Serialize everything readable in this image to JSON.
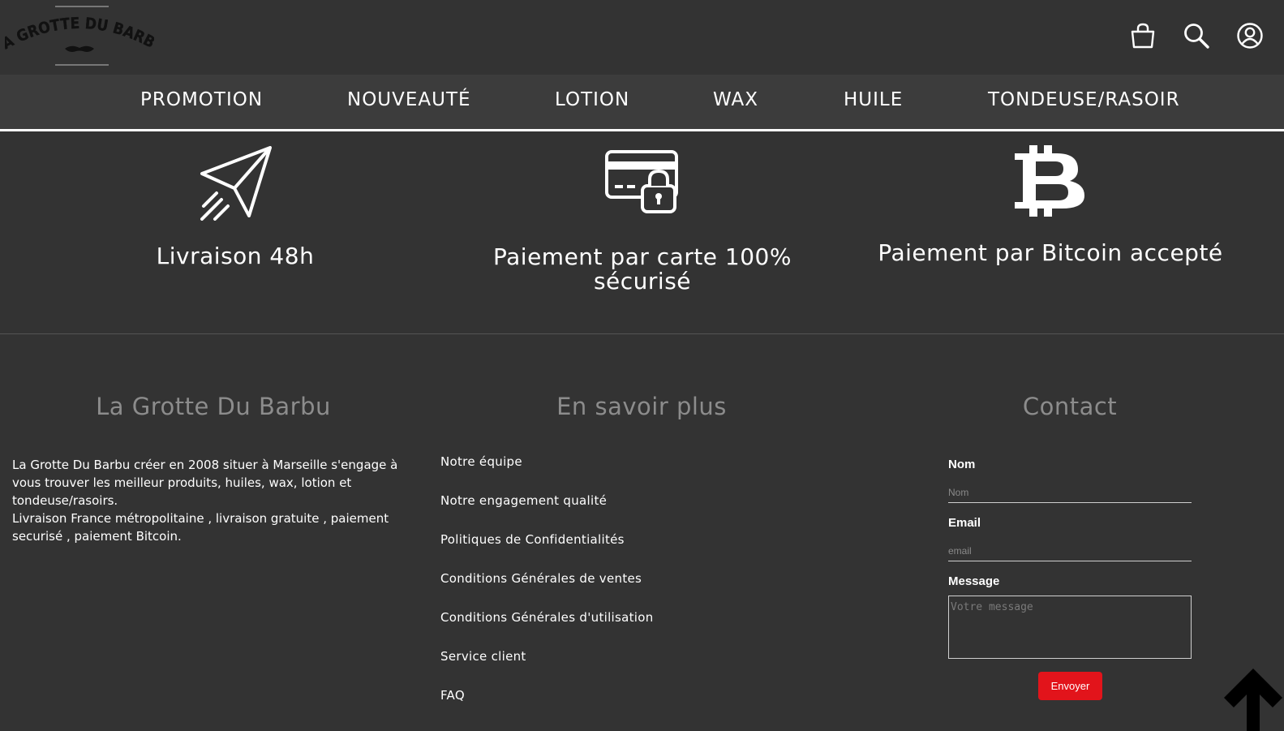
{
  "header": {
    "logo_text": "LA GROTTE DU BARBU",
    "icons": [
      "shopping-bag-icon",
      "search-icon",
      "user-account-icon"
    ]
  },
  "nav": {
    "items": [
      "PROMOTION",
      "NOUVEAUTÉ",
      "LOTION",
      "WAX",
      "HUILE",
      "TONDEUSE/RASOIR"
    ]
  },
  "features": [
    {
      "icon": "paper-plane-icon",
      "text": "Livraison 48h"
    },
    {
      "icon": "secure-card-icon",
      "text": "Paiement par carte 100% sécurisé"
    },
    {
      "icon": "bitcoin-icon",
      "text": "Paiement par Bitcoin accepté"
    }
  ],
  "footer": {
    "about": {
      "title": "La Grotte Du Barbu",
      "paragraph1": "La Grotte Du Barbu créer en 2008 situer à Marseille s'engage à vous trouver les meilleur produits, huiles, wax, lotion et tondeuse/rasoirs.",
      "paragraph2": "Livraison France métropolitaine , livraison gratuite , paiement securisé , paiement Bitcoin."
    },
    "more": {
      "title": "En savoir plus",
      "links": [
        "Notre équipe",
        "Notre engagement qualité",
        "Politiques de Confidentialités",
        "Conditions Générales de ventes",
        "Conditions Générales d'utilisation",
        "Service client",
        "FAQ"
      ]
    },
    "contact": {
      "title": "Contact",
      "name_label": "Nom",
      "name_placeholder": "Nom",
      "email_label": "Email",
      "email_placeholder": "email",
      "message_label": "Message",
      "message_placeholder": "Votre message",
      "submit_label": "Envoyer"
    }
  },
  "colors": {
    "background": "#333333",
    "nav_background": "#3c3c3c",
    "title_grey": "#8c8c8c",
    "button_red": "#e2141b"
  }
}
